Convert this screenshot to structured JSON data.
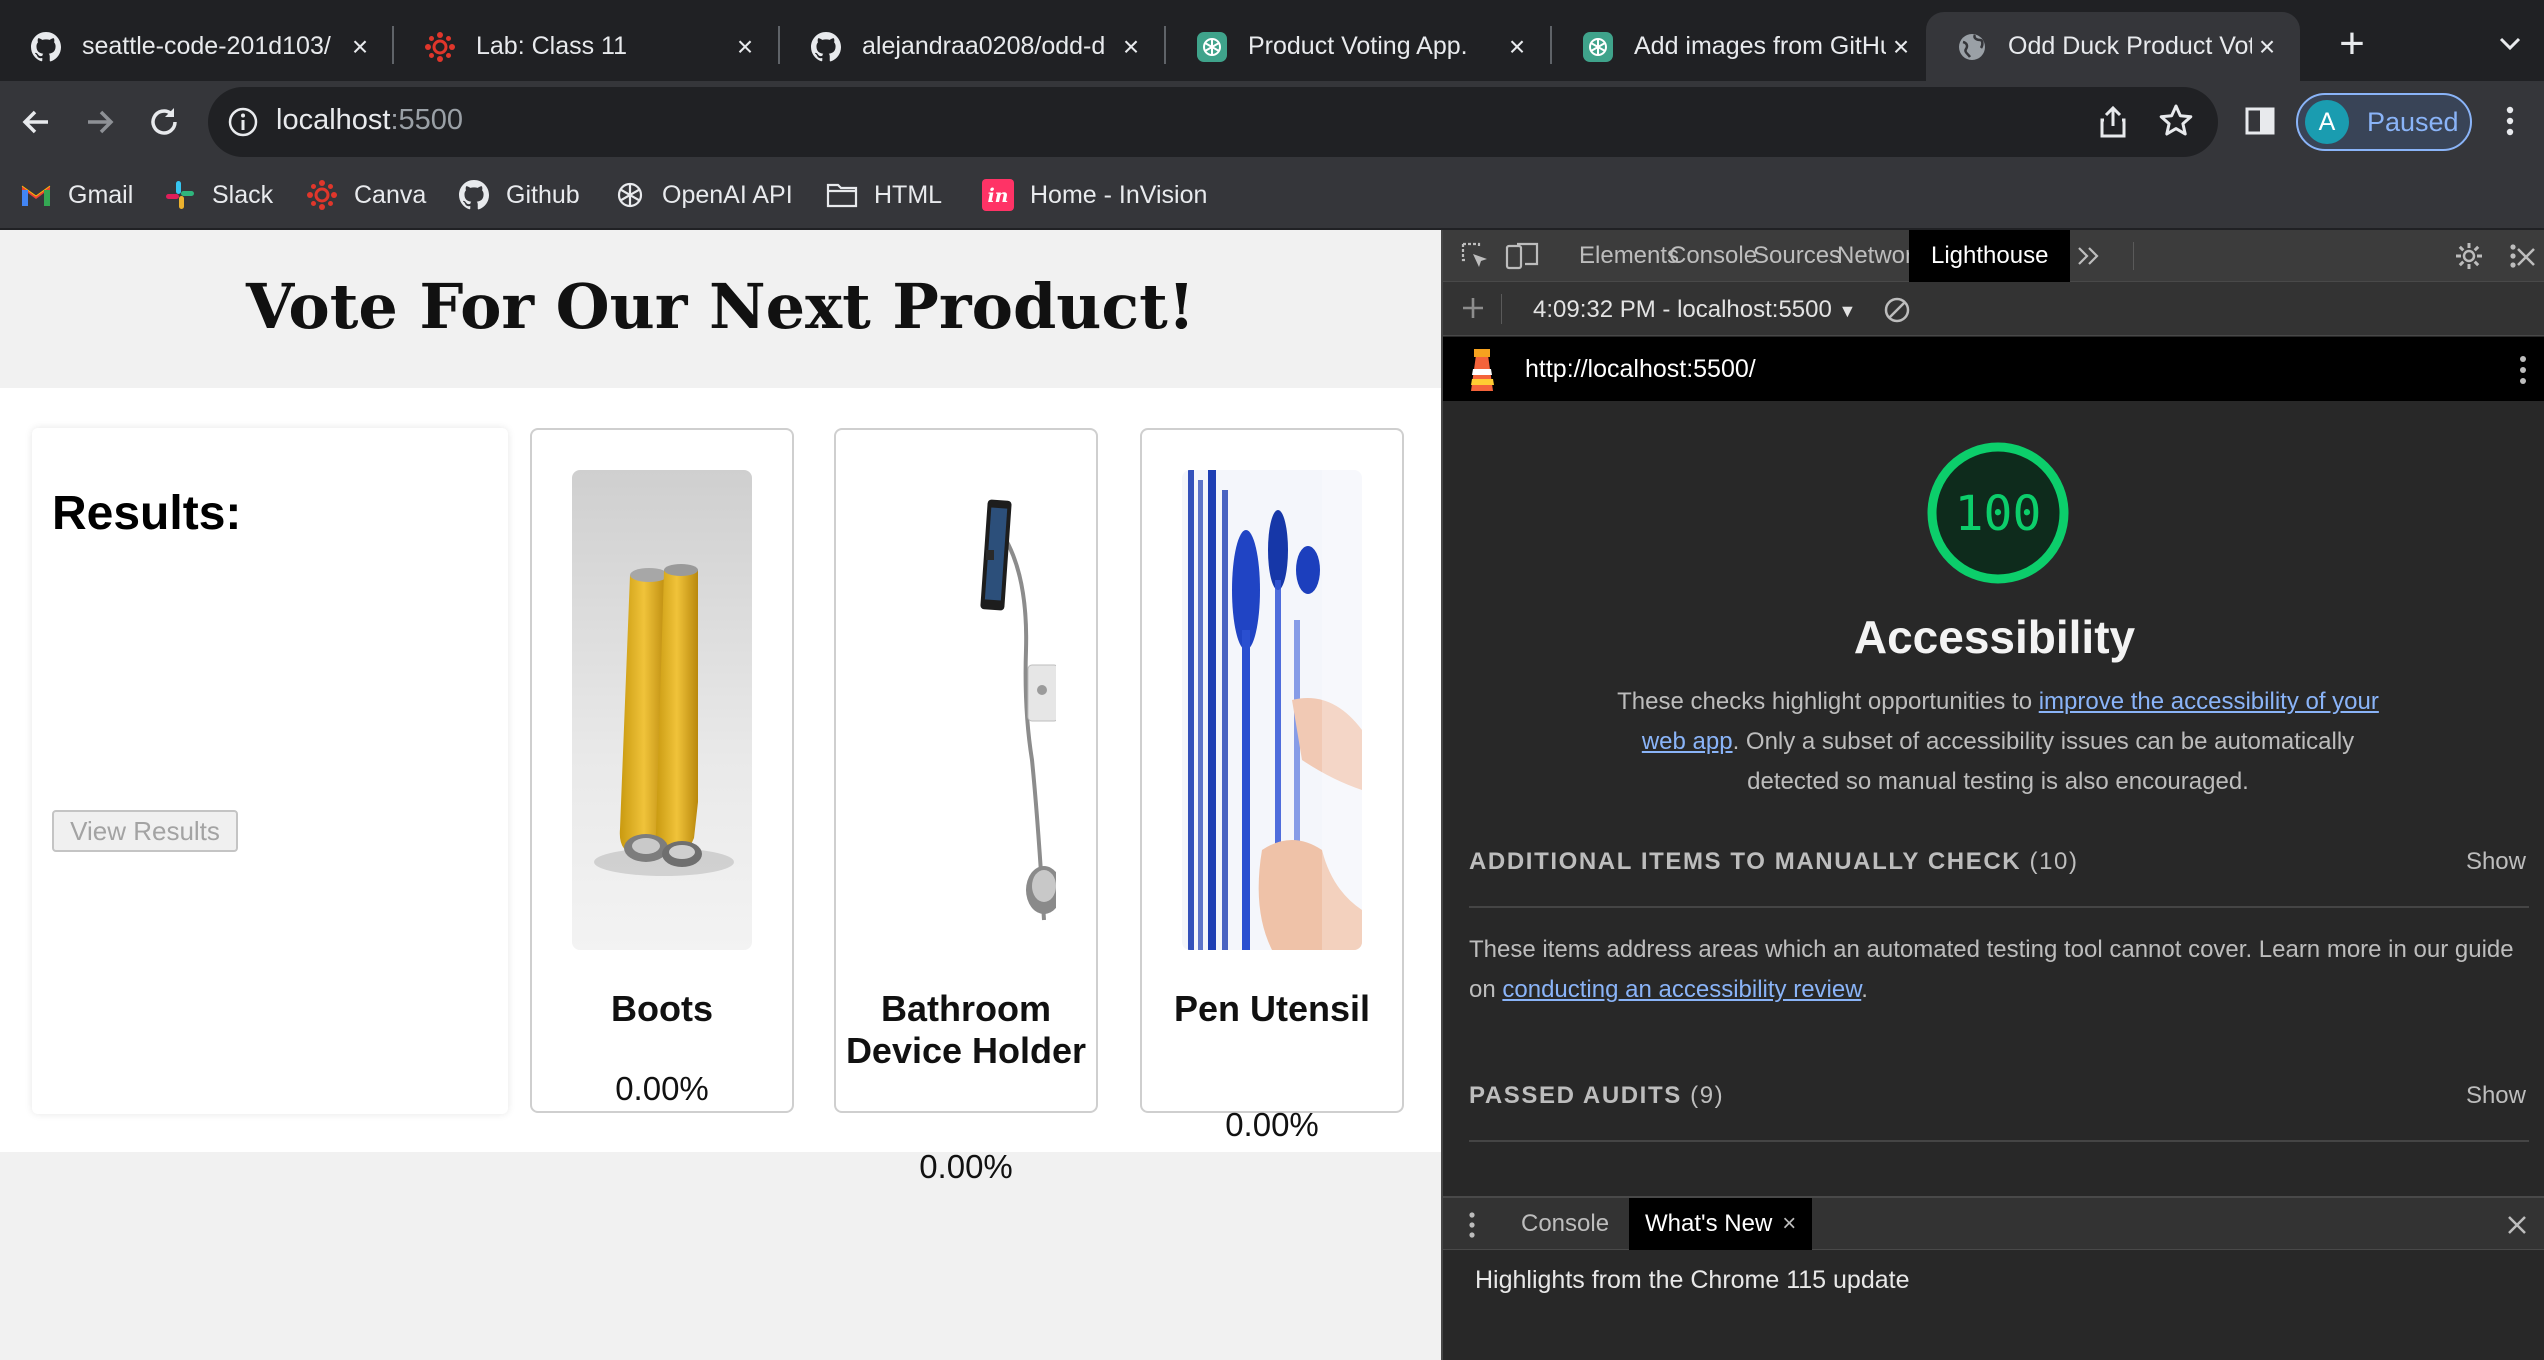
{
  "browser": {
    "tabs": [
      {
        "title": "seattle-code-201d103/",
        "icon": "github-icon",
        "active": false
      },
      {
        "title": "Lab: Class 11",
        "icon": "canvas-icon",
        "active": false
      },
      {
        "title": "alejandraa0208/odd-d",
        "icon": "github-icon",
        "active": false
      },
      {
        "title": "Product Voting App.",
        "icon": "openai-icon",
        "active": false
      },
      {
        "title": "Add images from GitHub",
        "icon": "openai-icon",
        "active": false
      },
      {
        "title": "Odd Duck Product Vot",
        "icon": "globe-icon",
        "active": true
      }
    ],
    "url_host": "localhost",
    "url_port": ":5500",
    "profile_initial": "A",
    "profile_status": "Paused",
    "bookmarks": [
      {
        "label": "Gmail",
        "icon": "gmail-icon"
      },
      {
        "label": "Slack",
        "icon": "slack-icon"
      },
      {
        "label": "Canva",
        "icon": "canva-icon"
      },
      {
        "label": "Github",
        "icon": "github-icon"
      },
      {
        "label": "OpenAI API",
        "icon": "openai-icon"
      },
      {
        "label": "HTML",
        "icon": "folder-icon"
      },
      {
        "label": "Home - InVision",
        "icon": "invision-icon"
      }
    ]
  },
  "page": {
    "title": "Vote For Our Next Product!",
    "results_heading": "Results:",
    "view_results_label": "View Results",
    "products": [
      {
        "name": "Boots",
        "percent": "0.00%"
      },
      {
        "name": "Bathroom Device Holder",
        "percent": "0.00%"
      },
      {
        "name": "Pen Utensil",
        "percent": "0.00%"
      }
    ]
  },
  "devtools": {
    "tabs": [
      "Elements",
      "Console",
      "Sources",
      "Network",
      "Lighthouse"
    ],
    "active_tab": "Lighthouse",
    "report_label": "4:09:32 PM - localhost:5500",
    "report_url": "http://localhost:5500/",
    "score": "100",
    "category_title": "Accessibility",
    "desc_before": "These checks highlight opportunities to ",
    "desc_link": "improve the accessibility of your web app",
    "desc_after": ". Only a subset of accessibility issues can be automatically detected so manual testing is also encouraged.",
    "manual_group": {
      "title": "ADDITIONAL ITEMS TO MANUALLY CHECK",
      "count": "(10)",
      "show": "Show"
    },
    "manual_desc_before": "These items address areas which an automated testing tool cannot cover. Learn more in our guide on ",
    "manual_desc_link": "conducting an accessibility review",
    "manual_desc_after": ".",
    "passed_group": {
      "title": "PASSED AUDITS",
      "count": "(9)",
      "show": "Show"
    },
    "drawer_tabs": [
      "Console",
      "What's New"
    ],
    "drawer_active": "What's New",
    "whats_new_text": "Highlights from the Chrome 115 update"
  },
  "colors": {
    "score_green": "#0cce6b",
    "link_blue": "#8ab4f8",
    "chrome_dark": "#202124",
    "toolbar": "#35363a"
  }
}
